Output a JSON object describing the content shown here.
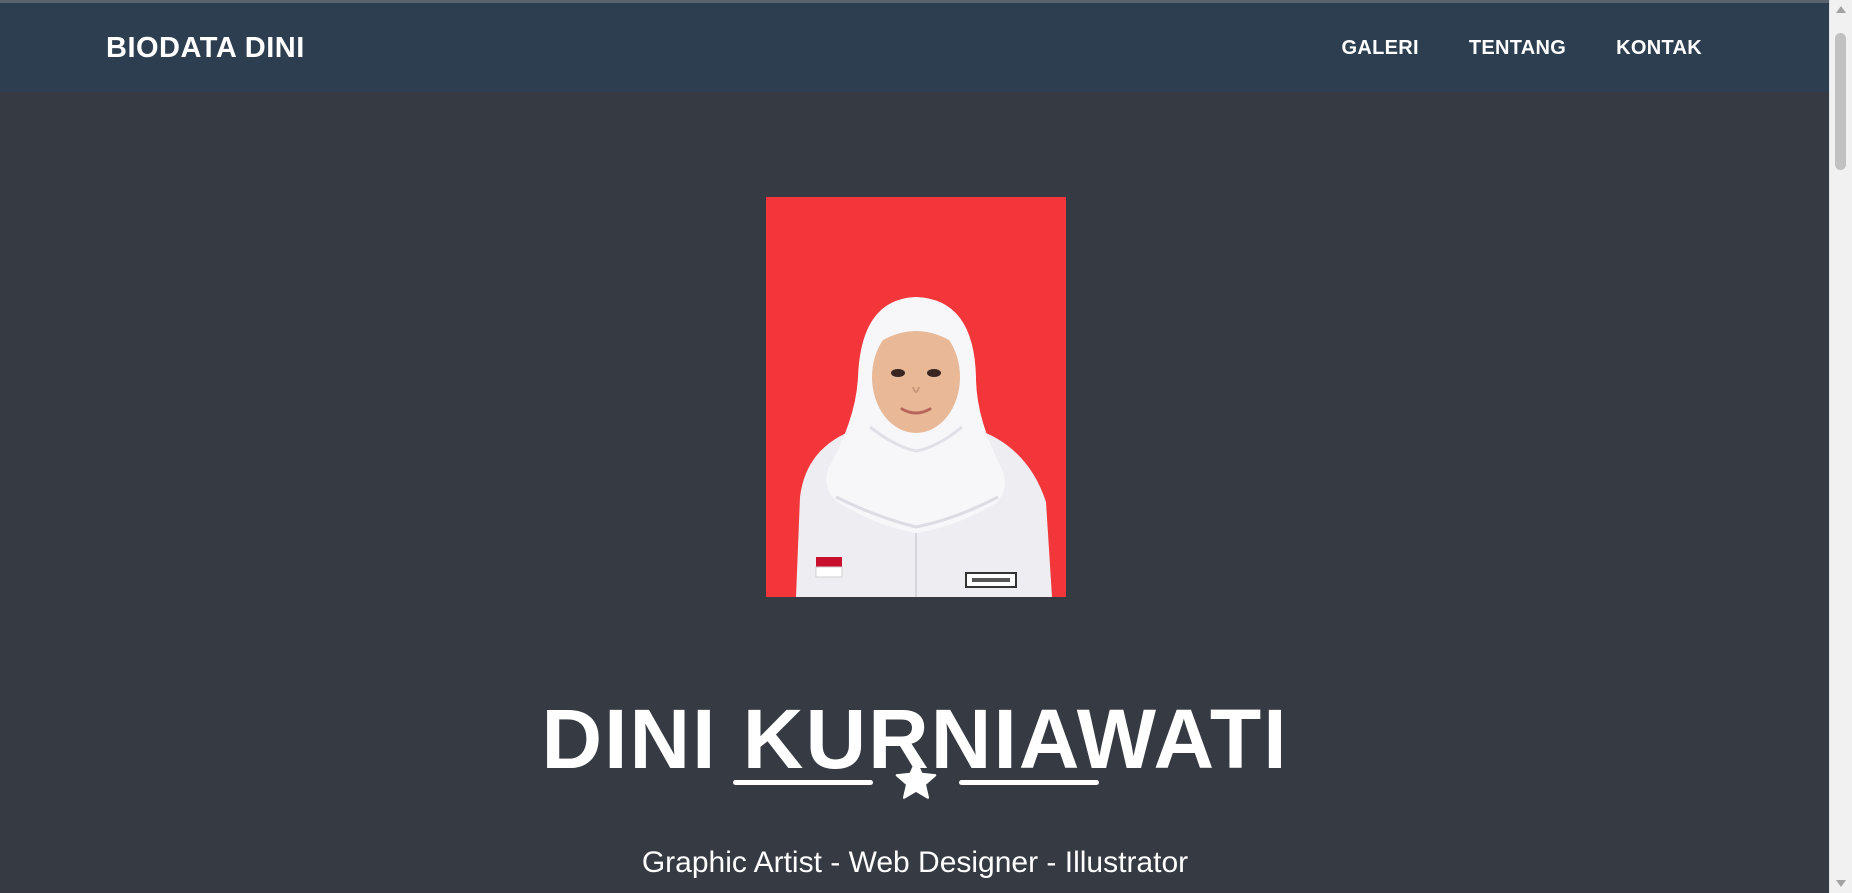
{
  "navbar": {
    "brand": "BIODATA DINI",
    "links": [
      {
        "label": "GALERI"
      },
      {
        "label": "TENTANG"
      },
      {
        "label": "KONTAK"
      }
    ]
  },
  "header": {
    "photo_icon": "profile-photo",
    "name": "DINI KURNIAWATI",
    "divider_icon": "star-icon",
    "subtitle": "Graphic Artist - Web Designer - Illustrator"
  },
  "colors": {
    "navbar_bg": "#2c3e50",
    "page_bg": "#363a42",
    "photo_bg": "#f2363a",
    "text": "#ffffff"
  }
}
